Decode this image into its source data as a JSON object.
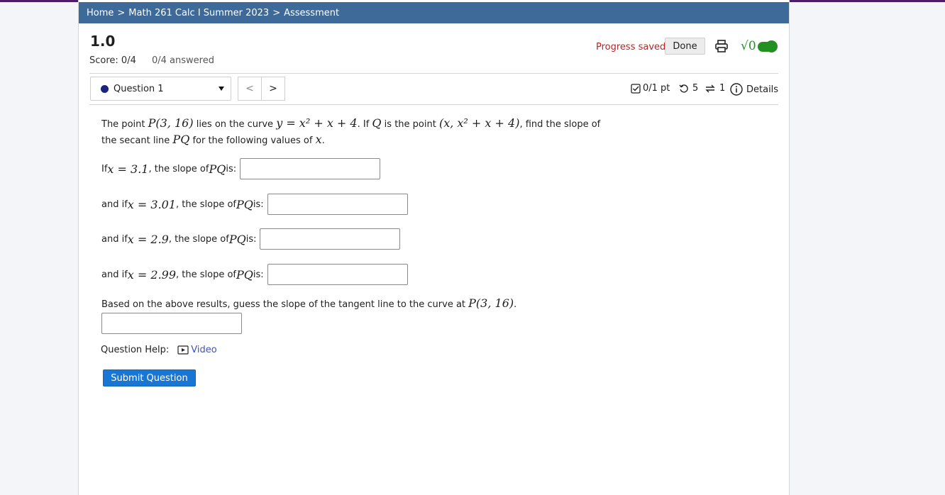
{
  "breadcrumb": {
    "home": "Home",
    "course": "Math 261 Calc I Summer 2023",
    "current": "Assessment",
    "sep": ">"
  },
  "header": {
    "version": "1.0",
    "score": "Score: 0/4",
    "answered": "0/4 answered",
    "progress": "Progress saved",
    "done": "Done",
    "sqrt_label": "√0"
  },
  "question_nav": {
    "selected": "Question 1",
    "prev": "<",
    "next": ">"
  },
  "question_meta": {
    "points": "0/1 pt",
    "retries": "5",
    "attempts": "1",
    "details": "Details"
  },
  "problem": {
    "intro_1": "The point ",
    "P": "P(3, 16)",
    "intro_2": " lies on the curve ",
    "curve": "y = x² + x + 4",
    "intro_3": ". If ",
    "Q": "Q",
    "intro_4": " is the point ",
    "Qpoint": "(x, x² + x + 4)",
    "intro_5": ", find the slope of",
    "line2_1": "the secant line ",
    "PQ": "PQ",
    "line2_2": " for the following values of ",
    "x": "x",
    "line2_3": "."
  },
  "parts": [
    {
      "prefix": "If ",
      "xeq": "x = 3.1",
      "suffix": ", the slope of ",
      "pq": "PQ",
      "is": " is:"
    },
    {
      "prefix": "and if ",
      "xeq": "x = 3.01",
      "suffix": ", the slope of ",
      "pq": "PQ",
      "is": " is:"
    },
    {
      "prefix": "and if ",
      "xeq": "x = 2.9",
      "suffix": ", the slope of ",
      "pq": "PQ",
      "is": " is:"
    },
    {
      "prefix": "and if ",
      "xeq": "x = 2.99",
      "suffix": ", the slope of ",
      "pq": "PQ",
      "is": " is:"
    }
  ],
  "tangent": {
    "text": "Based on the above results, guess the slope of the tangent line to the curve at ",
    "point": "P(3, 16)",
    "end": "."
  },
  "help": {
    "label": "Question Help:",
    "video": "Video"
  },
  "submit": "Submit Question",
  "colors": {
    "breadcrumb_bg": "#3d6a99",
    "progress_saved": "#c22121",
    "submit_bg": "#1976d2",
    "accent_green": "#239023"
  }
}
